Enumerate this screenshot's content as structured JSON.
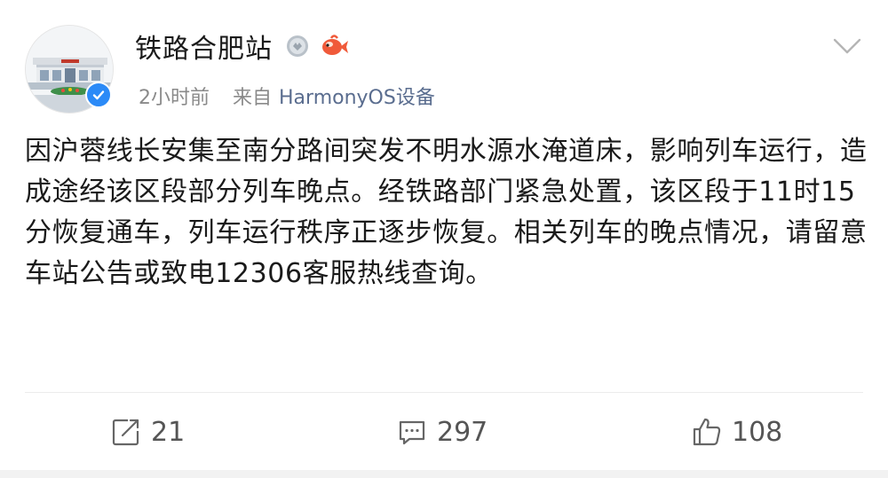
{
  "header": {
    "username": "铁路合肥站",
    "time": "2小时前",
    "from_label": "来自",
    "device": "HarmonyOS设备"
  },
  "post": {
    "text": "因沪蓉线长安集至南分路间突发不明水源水淹道床，影响列车运行，造成途经该区段部分列车晚点。经铁路部门紧急处置，该区段于11时15分恢复通车，列车运行秩序正逐步恢复。相关列车的晚点情况，请留意车站公告或致电12306客服热线查询。"
  },
  "actions": {
    "repost_count": "21",
    "comment_count": "297",
    "like_count": "108"
  },
  "icons": {
    "avatar": "train-station-avatar",
    "verified": "verified-badge-icon",
    "medal": "medal-icon",
    "fish": "koi-fish-icon",
    "menu": "chevron-down-icon",
    "repost": "share-icon",
    "comment": "comment-icon",
    "like": "thumbs-up-icon"
  },
  "colors": {
    "verified": "#2b8af7",
    "device_link": "#5a6d8f",
    "text": "#1a1a1a",
    "meta": "#8a8a8a"
  }
}
